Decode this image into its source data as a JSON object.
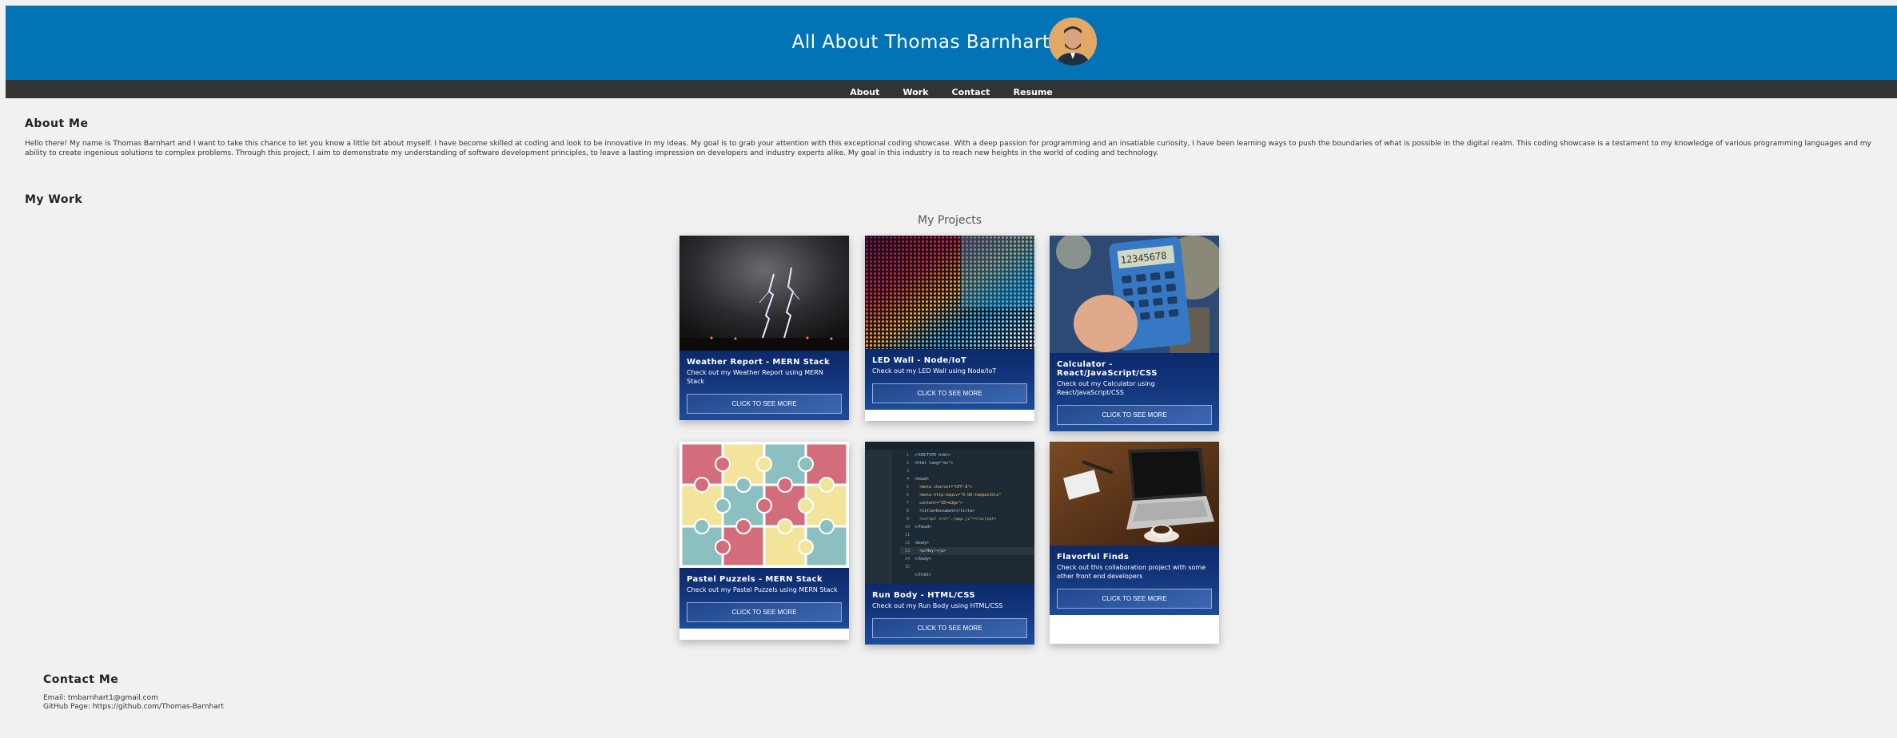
{
  "header": {
    "title": "All About Thomas Barnhart",
    "brand_color": "#0274b6"
  },
  "nav": {
    "items": [
      {
        "label": "About"
      },
      {
        "label": "Work"
      },
      {
        "label": "Contact"
      },
      {
        "label": "Resume"
      }
    ]
  },
  "about": {
    "heading": "About Me",
    "text": "Hello there! My name is Thomas Barnhart and I want to take this chance to let you know a little bit about myself. I have become skilled at coding and look to be innovative in my ideas. My goal is to grab your attention with this exceptional coding showcase. With a deep passion for programming and an insatiable curiosity, I have been learning ways to push the boundaries of what is possible in the digital realm. This coding showcase is a testament to my knowledge of various programming languages and my ability to create ingenious solutions to complex problems. Through this project, I aim to demonstrate my understanding of software development principles, to leave a lasting impression on developers and industry experts alike. My goal in this industry is to reach new heights in the world of coding and technology."
  },
  "work": {
    "heading": "My Work",
    "projects_title": "My Projects",
    "projects": [
      {
        "title": "Weather Report - MERN Stack",
        "desc": "Check out my Weather Report using MERN Stack",
        "button": "CLICK TO SEE MORE",
        "image": "lightning-storm"
      },
      {
        "title": "LED Wall - Node/IoT",
        "desc": "Check out my LED Wall using Node/IoT",
        "button": "CLICK TO SEE MORE",
        "image": "led-wall"
      },
      {
        "title": "Calculator - React/JavaScript/CSS",
        "desc": "Check out my Calculator using React/JavaScript/CSS",
        "button": "CLICK TO SEE MORE",
        "image": "calculator"
      },
      {
        "title": "Pastel Puzzels - MERN Stack",
        "desc": "Check out my Pastel Puzzels using MERN Stack",
        "button": "CLICK TO SEE MORE",
        "image": "puzzle-pieces"
      },
      {
        "title": "Run Body - HTML/CSS",
        "desc": "Check out my Run Body using HTML/CSS",
        "button": "CLICK TO SEE MORE",
        "image": "code-editor"
      },
      {
        "title": "Flavorful Finds",
        "desc": "Check out this collaboration project with some other front end developers",
        "button": "CLICK TO SEE MORE",
        "image": "laptop-coffee"
      }
    ]
  },
  "contact": {
    "heading": "Contact Me",
    "email": "Email: tmbarnhart1@gmail.com",
    "github": "GitHub Page: https://github.com/Thomas-Barnhart"
  }
}
